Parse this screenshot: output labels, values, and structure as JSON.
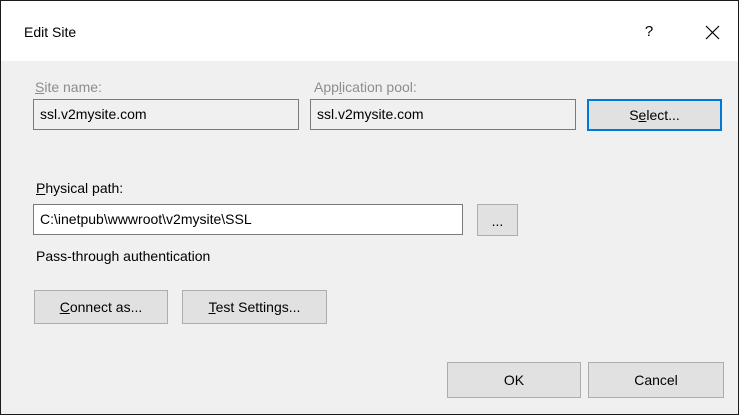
{
  "dialog": {
    "title": "Edit Site",
    "help_glyph": "?",
    "close_glyph": "✕"
  },
  "site_name": {
    "label_key": "S",
    "label_rest": "ite name:",
    "value": "ssl.v2mysite.com"
  },
  "app_pool": {
    "label_pre": "App",
    "label_key": "l",
    "label_rest": "ication pool:",
    "value": "ssl.v2mysite.com"
  },
  "select_button": {
    "pre": "S",
    "key": "e",
    "rest": "lect..."
  },
  "physical_path": {
    "label_key": "P",
    "label_rest": "hysical path:",
    "value": "C:\\inetpub\\wwwroot\\v2mysite\\SSL",
    "browse_label": "..."
  },
  "pass_through_text": "Pass-through authentication",
  "connect_as_button": {
    "key": "C",
    "rest": "onnect as..."
  },
  "test_settings_button": {
    "pre": "",
    "key": "T",
    "rest": "est Settings..."
  },
  "ok_label": "OK",
  "cancel_label": "Cancel"
}
